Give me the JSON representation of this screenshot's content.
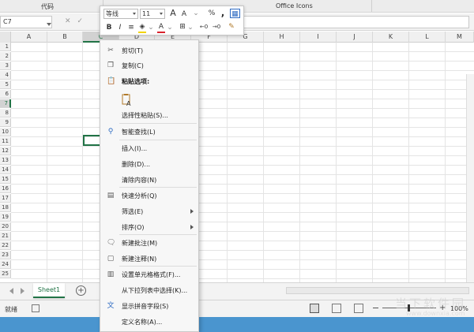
{
  "ribbon": {
    "groups": [
      "代码",
      "Office Icons"
    ]
  },
  "formula_bar": {
    "name_box": "C7",
    "cancel_icon": "close-icon",
    "enter_icon": "check-icon",
    "formula_value": ""
  },
  "grid": {
    "columns": [
      "A",
      "B",
      "C",
      "D",
      "E",
      "F",
      "G",
      "H",
      "I",
      "J",
      "K",
      "L",
      "M"
    ],
    "rows": [
      "1",
      "2",
      "3",
      "4",
      "5",
      "6",
      "7",
      "8",
      "9",
      "10",
      "11",
      "12",
      "13",
      "14",
      "15",
      "16",
      "17",
      "18",
      "19",
      "20",
      "21",
      "22",
      "23",
      "24",
      "25"
    ],
    "active_column": "C",
    "active_row": "7"
  },
  "mini_toolbar": {
    "font_name": "等线",
    "font_size": "11",
    "grow_font": "A",
    "shrink_font": "A",
    "percent": "%",
    "comma": ",",
    "bold": "B",
    "italic": "I",
    "font_color": "A",
    "colors": {
      "fill": "#f2d300",
      "font": "#d9232d"
    }
  },
  "context_menu": {
    "cut": "剪切(T)",
    "copy": "复制(C)",
    "paste_options": "粘贴选项:",
    "paste_special": "选择性粘贴(S)...",
    "smart_lookup": "智能查找(L)",
    "insert": "插入(I)...",
    "delete": "删除(D)...",
    "clear": "清除内容(N)",
    "quick_analysis": "快速分析(Q)",
    "filter": "筛选(E)",
    "sort": "排序(O)",
    "new_comment": "新建批注(M)",
    "new_note": "新建注释(N)",
    "format_cells": "设置单元格格式(F)...",
    "pick_list": "从下拉列表中选择(K)...",
    "phonetic": "显示拼音字段(S)",
    "define_name": "定义名称(A)..."
  },
  "sheet_tabs": {
    "active": "Sheet1",
    "add": "+"
  },
  "status_bar": {
    "status": "就绪",
    "zoom": "100%"
  },
  "watermark": {
    "text": "当下软件园",
    "url": "www.downxia.com"
  }
}
